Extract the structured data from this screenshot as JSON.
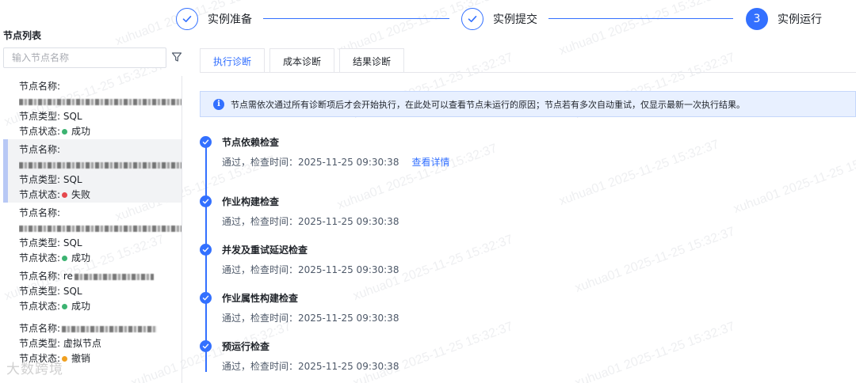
{
  "steps": [
    {
      "label": "实例准备",
      "state": "done"
    },
    {
      "label": "实例提交",
      "state": "done"
    },
    {
      "number": "3",
      "label": "实例运行",
      "state": "active"
    }
  ],
  "sidebar": {
    "title": "节点列表",
    "search_placeholder": "输入节点名称",
    "nodes": [
      {
        "name_label": "节点名称:",
        "type_label": "节点类型: SQL",
        "status_label": "节点状态:",
        "status": "成功",
        "status_color": "#3cb371"
      },
      {
        "name_label": "节点名称:",
        "type_label": "节点类型: SQL",
        "status_label": "节点状态:",
        "status": "失败",
        "status_color": "#e5484d"
      },
      {
        "name_label": "节点名称:",
        "type_label": "节点类型: SQL",
        "status_label": "节点状态:",
        "status": "成功",
        "status_color": "#3cb371"
      },
      {
        "name_label": "节点名称: re",
        "type_label": "节点类型: SQL",
        "status_label": "节点状态:",
        "status": "成功",
        "status_color": "#3cb371"
      },
      {
        "name_label": "节点名称:",
        "type_label": "节点类型: 虚拟节点",
        "status_label": "节点状态:",
        "status": "撤销",
        "status_color": "#f0a020"
      }
    ]
  },
  "tabs": [
    {
      "label": "执行诊断",
      "active": true
    },
    {
      "label": "成本诊断",
      "active": false
    },
    {
      "label": "结果诊断",
      "active": false
    }
  ],
  "notice": "节点需依次通过所有诊断项后才会开始执行，在此处可以查看节点未运行的原因；节点若有多次自动重试，仅显示最新一次执行结果。",
  "checks": [
    {
      "title": "节点依赖检查",
      "detail": "通过，检查时间：2025-11-25 09:30:38",
      "link": "查看详情"
    },
    {
      "title": "作业构建检查",
      "detail": "通过，检查时间：2025-11-25 09:30:38"
    },
    {
      "title": "并发及重试延迟检查",
      "detail": "通过，检查时间：2025-11-25 09:30:38"
    },
    {
      "title": "作业属性构建检查",
      "detail": "通过，检查时间：2025-11-25 09:30:38"
    },
    {
      "title": "预运行检查",
      "detail": "通过，检查时间：2025-11-25 09:30:38"
    }
  ],
  "watermark": "xuhua01 2025-11-25 15:32:37",
  "brand": "大数跨境",
  "colors": {
    "accent": "#3370ff",
    "success": "#3cb371",
    "fail": "#e5484d",
    "revoked": "#f0a020"
  }
}
